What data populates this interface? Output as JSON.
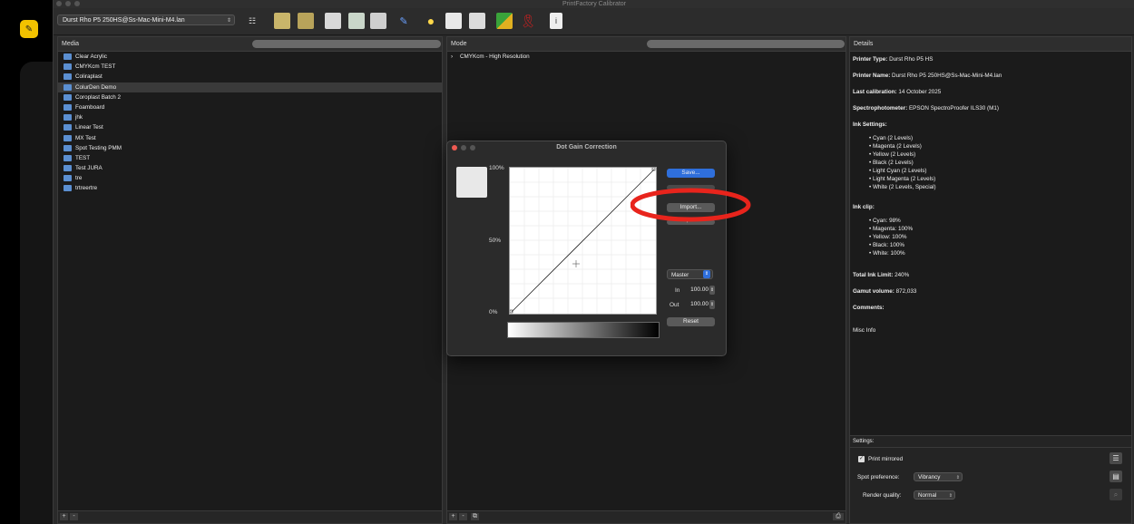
{
  "window": {
    "title": "PrintFactory Calibrator"
  },
  "toolbar": {
    "printer_select": "Durst Rho P5 250HS@Ss-Mac-Mini-M4.lan",
    "icons": [
      "list-icon",
      "media-icon",
      "media-alt-icon",
      "printer-icon",
      "printer-refresh-icon",
      "printer-settings-icon",
      "pen-icon",
      "sun-icon",
      "document-edit-icon",
      "clipboard-edit-icon",
      "color-swatch-icon",
      "ribbon-icon",
      "info-icon"
    ]
  },
  "media": {
    "header": "Media",
    "items": [
      "Clear Acrylic",
      "CMYKcm TEST",
      "Coliraplast",
      "ColurDen Demo",
      "Coroplast Batch 2",
      "Foamboard",
      "jhk",
      "Linear Test",
      "MX Test",
      "Spot Testing PMM",
      "TEST",
      "Test JURA",
      "tre",
      "trtreertre"
    ],
    "selected_index": 3
  },
  "mode": {
    "header": "Mode",
    "items": [
      "CMYKcm - High Resolution"
    ]
  },
  "details": {
    "header": "Details",
    "printer_type_label": "Printer Type:",
    "printer_type": "Durst Rho P5 HS",
    "printer_name_label": "Printer Name:",
    "printer_name": "Durst Rho P5 250HS@Ss-Mac-Mini-M4.lan",
    "last_cal_label": "Last calibration:",
    "last_cal": "14 October 2025",
    "spectro_label": "Spectrophotometer:",
    "spectro": "EPSON SpectroProofer ILS30 (M1)",
    "ink_settings_label": "Ink Settings:",
    "ink_settings": [
      "• Cyan (2 Levels)",
      "• Magenta (2 Levels)",
      "• Yellow (2 Levels)",
      "• Black (2 Levels)",
      "• Light Cyan (2 Levels)",
      "• Light Magenta (2 Levels)",
      "• White (2 Levels, Special)"
    ],
    "ink_clip_label": "Ink clip:",
    "ink_clip": [
      "• Cyan: 98%",
      "• Magenta: 100%",
      "• Yellow: 100%",
      "• Black: 100%",
      "• White: 100%"
    ],
    "total_ink_label": "Total Ink Limit:",
    "total_ink": "240%",
    "gamut_label": "Gamut volume:",
    "gamut": "872,033",
    "comments_label": "Comments:",
    "misc_label": "Misc Info"
  },
  "settings": {
    "header": "Settings:",
    "print_mirrored": "Print mirrored",
    "spot_label": "Spot preference:",
    "spot_value": "Vibrancy",
    "render_label": "Render quality:",
    "render_value": "Normal"
  },
  "dialog": {
    "title": "Dot Gain Correction",
    "save": "Save...",
    "import": "Import...",
    "export": "Export...",
    "channel": "Master",
    "in_label": "In",
    "in_value": "100.00",
    "out_label": "Out",
    "out_value": "100.00",
    "reset": "Reset",
    "y_top": "100%",
    "y_mid": "50%",
    "y_bot": "0%"
  },
  "colors": {
    "accent": "#2f6fdb",
    "highlight": "#e8241c",
    "window": "#2a2a2a",
    "panel": "#1b1b1b",
    "yellow_tile": "#f2c200"
  }
}
